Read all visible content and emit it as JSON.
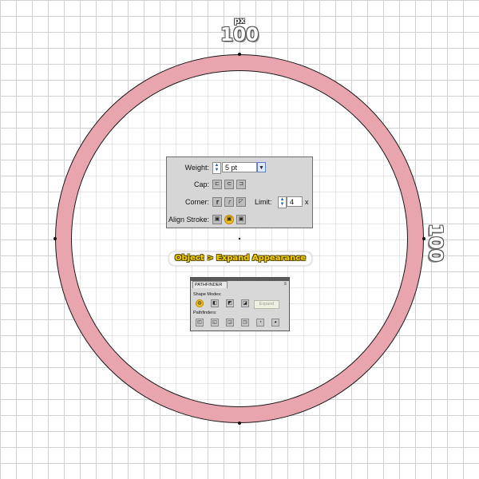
{
  "colors": {
    "ring_fill": "#e8a5ae",
    "ring_outline": "#1a1a1a",
    "grid": "#d2d2d2",
    "selected_button": "#f0c12a"
  },
  "dimensions": {
    "top": {
      "unit": "px",
      "value": "100"
    },
    "right": {
      "value": "100"
    }
  },
  "stroke_panel": {
    "weight_label": "Weight:",
    "weight_value": "5 pt",
    "cap_label": "Cap:",
    "corner_label": "Corner:",
    "limit_label": "Limit:",
    "limit_value": "4",
    "limit_suffix": "x",
    "align_stroke_label": "Align Stroke:",
    "cap_buttons": [
      "butt-cap-icon",
      "round-cap-icon",
      "projecting-cap-icon"
    ],
    "corner_buttons": [
      "miter-join-icon",
      "round-join-icon",
      "bevel-join-icon"
    ],
    "align_buttons": [
      "align-center-icon",
      "align-inside-icon",
      "align-outside-icon"
    ],
    "align_selected_index": 1
  },
  "caption": {
    "text": "Object > Expand Appearance"
  },
  "pathfinder_panel": {
    "tab_label": "PATHFINDER",
    "shape_modes_label": "Shape Modes:",
    "pathfinders_label": "Pathfinders:",
    "expand_label": "Expand",
    "shape_modes_selected_index": 0
  }
}
